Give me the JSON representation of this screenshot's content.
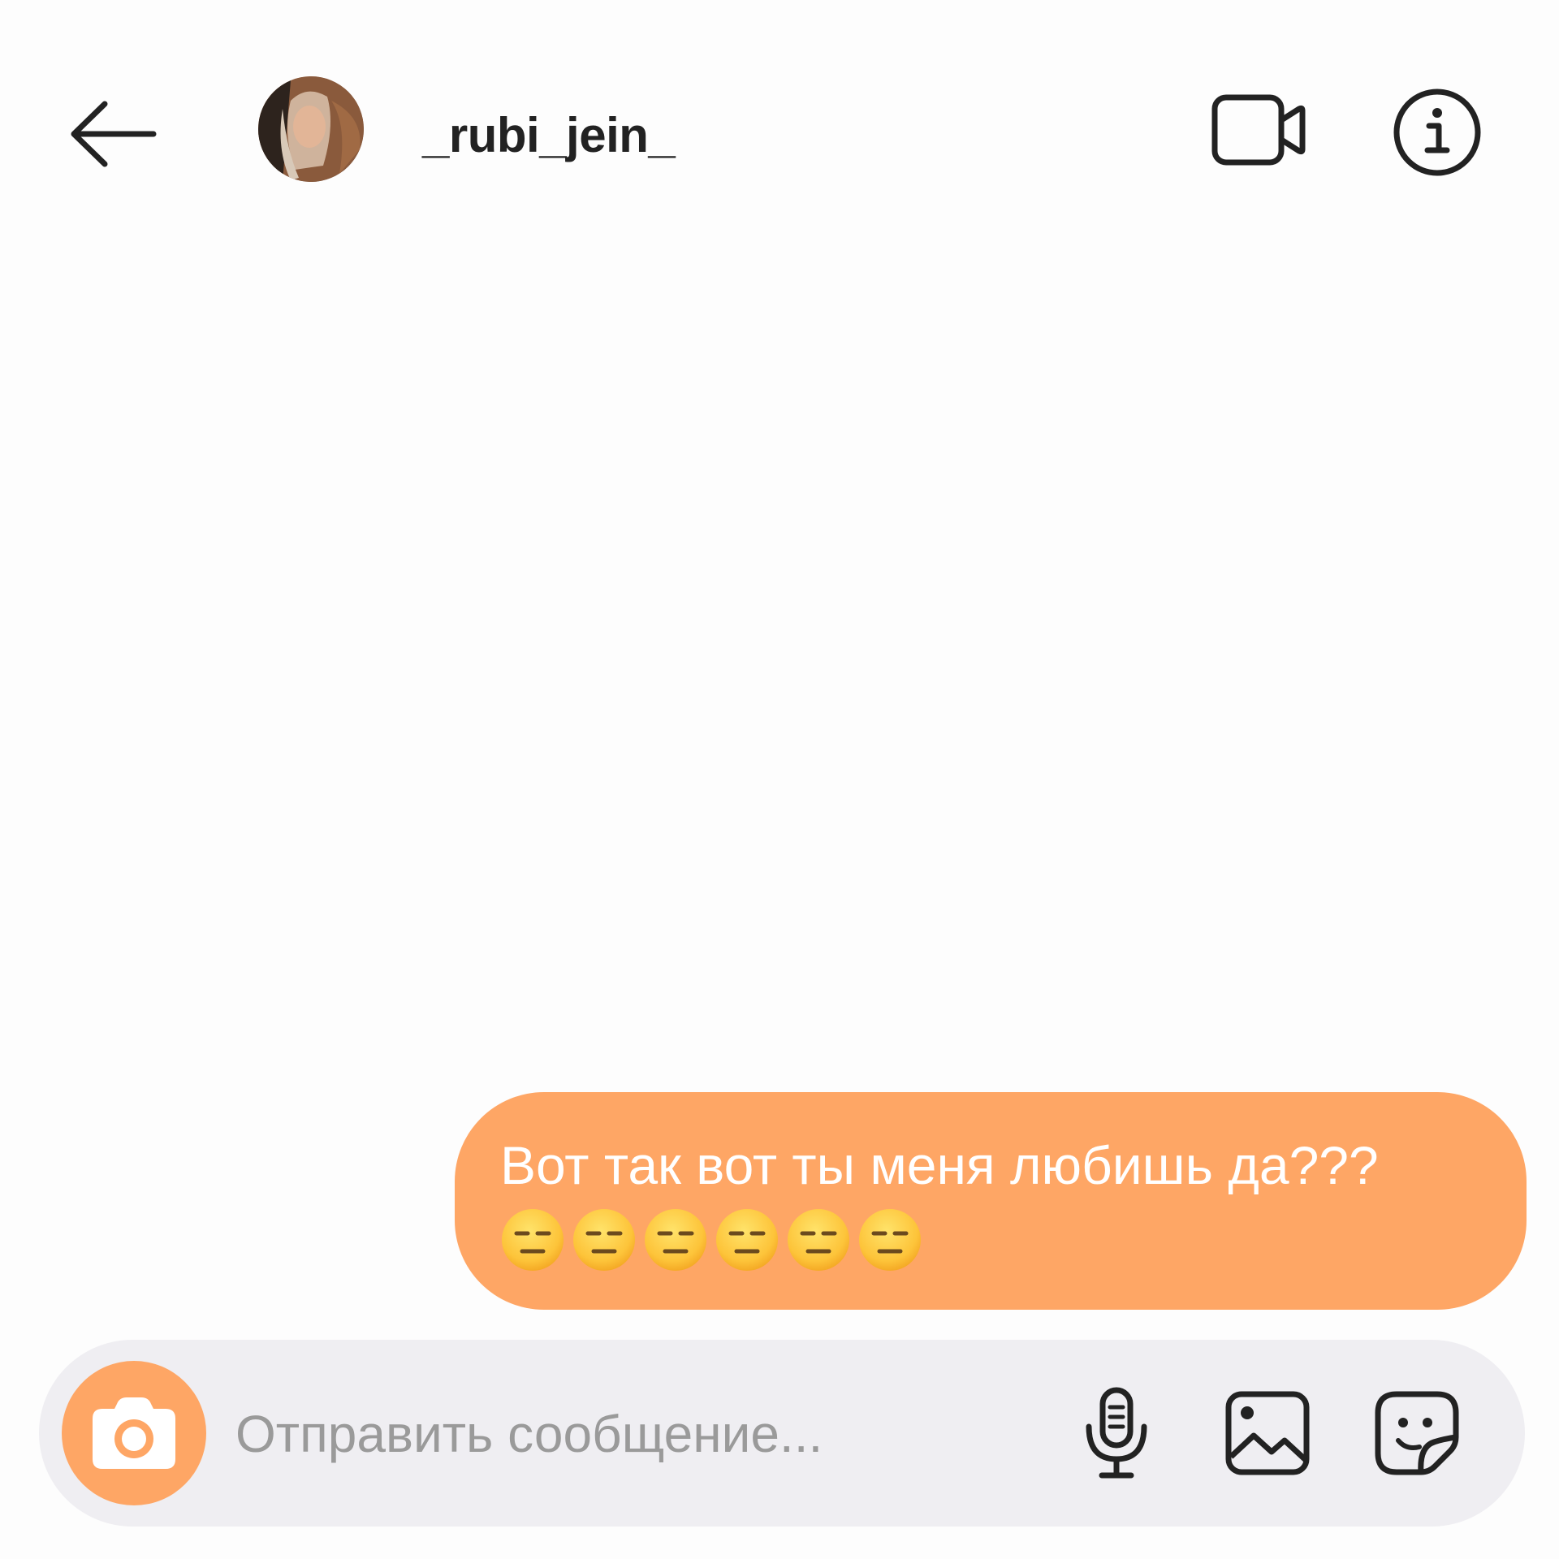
{
  "header": {
    "back_icon": "arrow-left-icon",
    "avatar_alt": "",
    "username": "_rubi_jein_",
    "video_icon": "video-camera-icon",
    "info_icon": "info-icon"
  },
  "messages": [
    {
      "direction": "outgoing",
      "text": "Вот так вот ты меня любишь да???",
      "emojis": [
        "😑",
        "😑",
        "😑",
        "😑",
        "😑",
        "😑"
      ]
    }
  ],
  "composer": {
    "placeholder": "Отправить сообщение...",
    "value": "",
    "camera_icon": "camera-icon",
    "mic_icon": "microphone-icon",
    "gallery_icon": "image-gallery-icon",
    "sticker_icon": "sticker-icon"
  },
  "colors": {
    "accent": "#fea665",
    "background": "#fdfdfd",
    "composer_bg": "#efeef2",
    "icon": "#222222",
    "placeholder": "#9a9a9a"
  }
}
